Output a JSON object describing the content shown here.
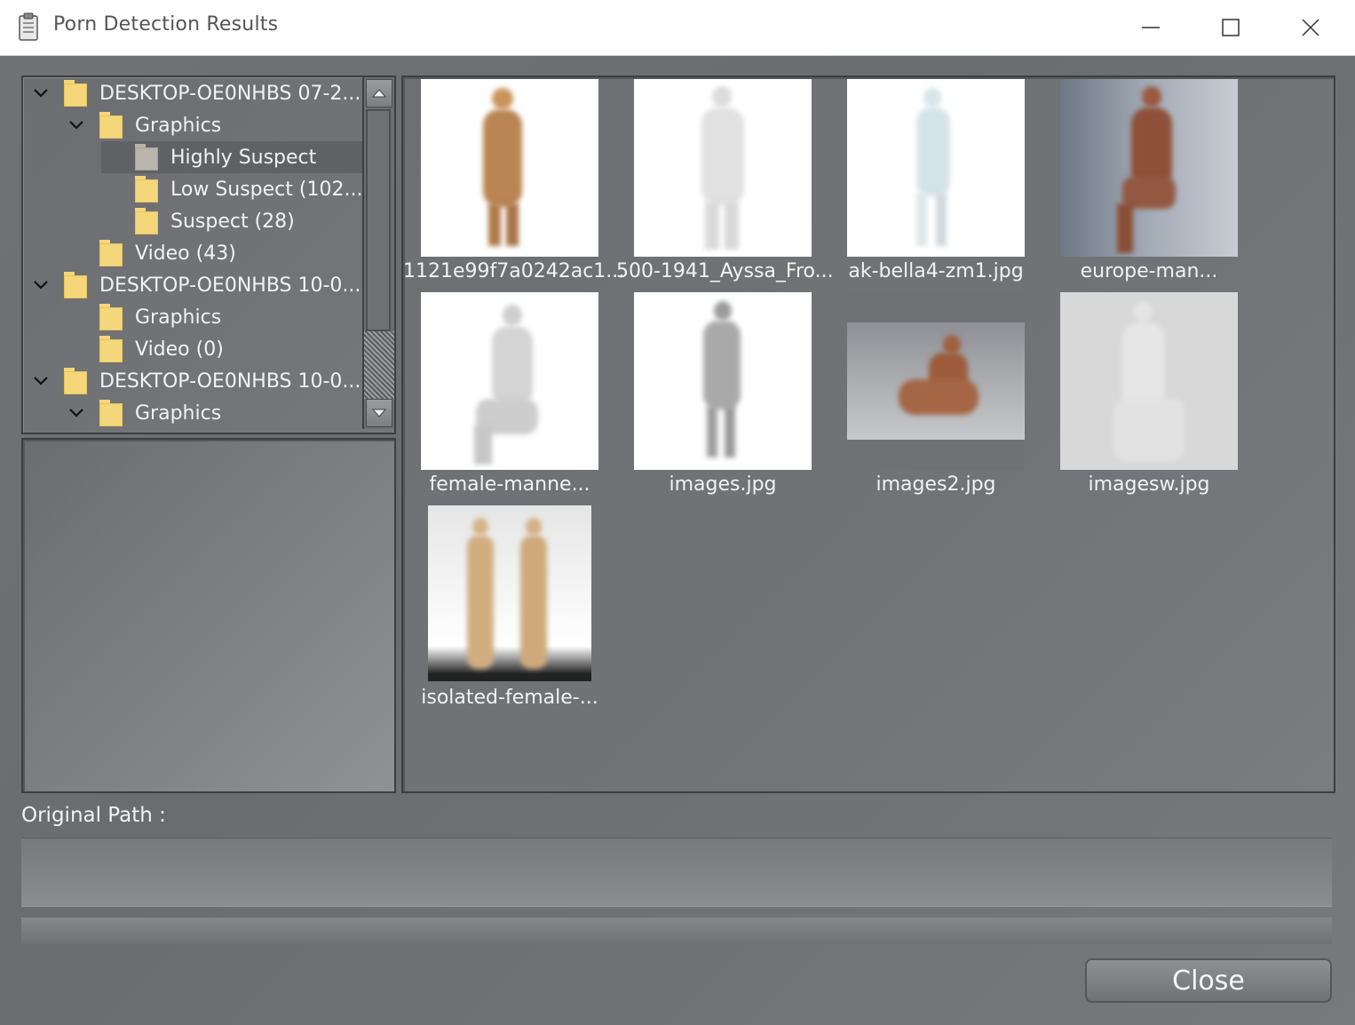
{
  "window": {
    "title": "Porn Detection Results"
  },
  "tree": {
    "items": [
      {
        "label": "DESKTOP-OE0NHBS 07-2...",
        "level": 0,
        "expanded": true,
        "selected": false,
        "folder_color": "yellow"
      },
      {
        "label": "Graphics",
        "level": 1,
        "expanded": true,
        "selected": false,
        "folder_color": "yellow"
      },
      {
        "label": "Highly Suspect",
        "level": 2,
        "expanded": false,
        "selected": true,
        "folder_color": "gray"
      },
      {
        "label": "Low Suspect (102...",
        "level": 2,
        "expanded": false,
        "selected": false,
        "folder_color": "yellow"
      },
      {
        "label": "Suspect (28)",
        "level": 2,
        "expanded": false,
        "selected": false,
        "folder_color": "yellow"
      },
      {
        "label": "Video (43)",
        "level": 1,
        "expanded": false,
        "selected": false,
        "folder_color": "yellow"
      },
      {
        "label": "DESKTOP-OE0NHBS 10-0...",
        "level": 0,
        "expanded": true,
        "selected": false,
        "folder_color": "yellow"
      },
      {
        "label": "Graphics",
        "level": 1,
        "expanded": false,
        "selected": false,
        "folder_color": "yellow"
      },
      {
        "label": "Video (0)",
        "level": 1,
        "expanded": false,
        "selected": false,
        "folder_color": "yellow"
      },
      {
        "label": "DESKTOP-OE0NHBS 10-0...",
        "level": 0,
        "expanded": true,
        "selected": false,
        "folder_color": "yellow"
      },
      {
        "label": "Graphics",
        "level": 1,
        "expanded": true,
        "selected": false,
        "folder_color": "yellow"
      }
    ]
  },
  "thumbnails": [
    {
      "caption": "1121e99f7a0242ac1..."
    },
    {
      "caption": "500-1941_Ayssa_Fro..."
    },
    {
      "caption": "ak-bella4-zm1.jpg"
    },
    {
      "caption": "europe-man..."
    },
    {
      "caption": "female-manne..."
    },
    {
      "caption": "images.jpg"
    },
    {
      "caption": "images2.jpg"
    },
    {
      "caption": "imagesw.jpg"
    },
    {
      "caption": "isolated-female-..."
    }
  ],
  "path": {
    "label": "Original Path :",
    "value": ""
  },
  "buttons": {
    "close": "Close"
  },
  "colors": {
    "folder_yellow": "#f4d77a",
    "panel_gray": "#6f7175",
    "text_light": "#f2f2f2"
  }
}
